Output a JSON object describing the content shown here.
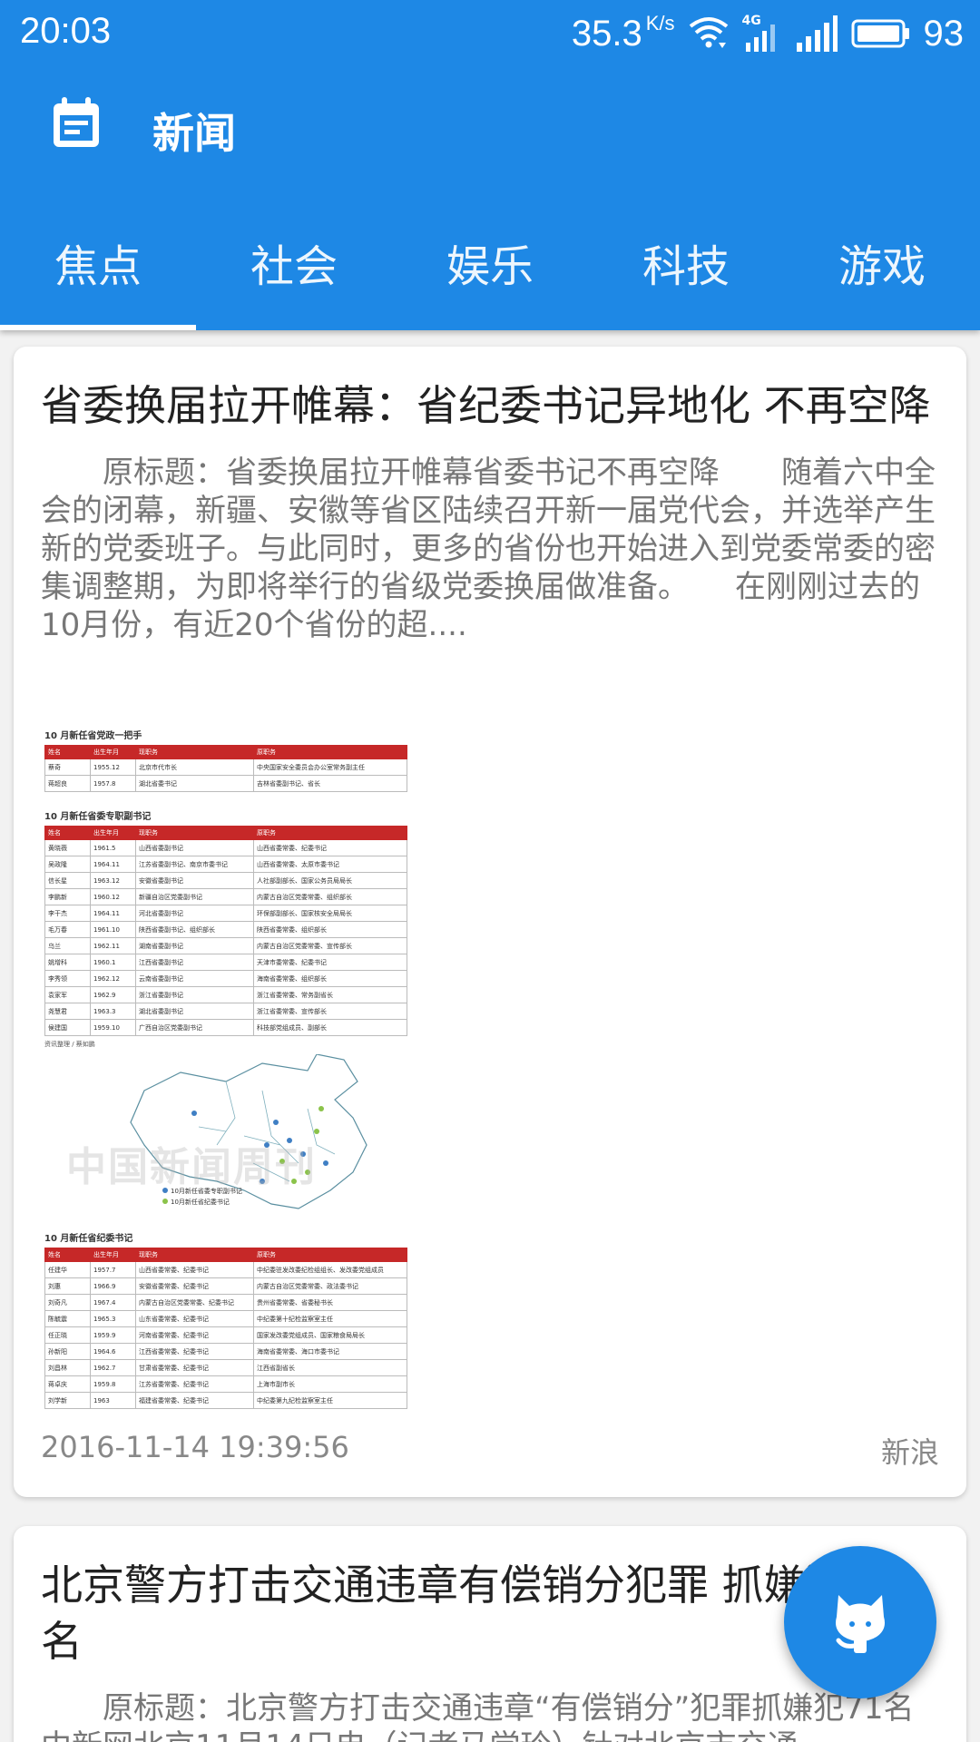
{
  "status_bar": {
    "time": "20:03",
    "net_speed": "35.3",
    "net_speed_unit": "K/s",
    "network_type": "4G",
    "battery": "93",
    "icons": [
      "wifi-icon",
      "signal-4g-icon",
      "signal-icon",
      "battery-icon"
    ]
  },
  "toolbar": {
    "title": "新闻",
    "icon": "calendar-icon"
  },
  "tabs": [
    {
      "label": "焦点",
      "active": true
    },
    {
      "label": "社会",
      "active": false
    },
    {
      "label": "娱乐",
      "active": false
    },
    {
      "label": "科技",
      "active": false
    },
    {
      "label": "游戏",
      "active": false
    }
  ],
  "articles": [
    {
      "title": "省委换届拉开帷幕：省纪委书记异地化 不再空降",
      "summary": "　　原标题：省委换届拉开帷幕省委书记不再空降　　随着六中全会的闭幕，新疆、安徽等省区陆续召开新一届党代会，并选举产生新的党委班子。与此同时，更多的省份也开始进入到党委常委的密集调整期，为即将举行的省级党委换届做准备。　　在刚刚过去的10月份，有近20个省份的超....",
      "time": "2016-11-14 19:39:56",
      "source": "新浪",
      "figure": {
        "table1": {
          "caption": "10 月新任省党政一把手",
          "headers": [
            "姓名",
            "出生年月",
            "现职务",
            "原职务"
          ],
          "rows": [
            [
              "蔡奇",
              "1955.12",
              "北京市代市长",
              "中央国家安全委员会办公室常务副主任"
            ],
            [
              "蒋超良",
              "1957.8",
              "湖北省委书记",
              "吉林省委副书记、省长"
            ]
          ]
        },
        "table2": {
          "caption": "10 月新任省委专职副书记",
          "headers": [
            "姓名",
            "出生年月",
            "现职务",
            "原职务"
          ],
          "rows": [
            [
              "黄晓薇",
              "1961.5",
              "山西省委副书记",
              "山西省委常委、纪委书记"
            ],
            [
              "吴政隆",
              "1964.11",
              "江苏省委副书记、南京市委书记",
              "山西省委常委、太原市委书记"
            ],
            [
              "信长星",
              "1963.12",
              "安徽省委副书记",
              "人社部副部长、国家公务员局局长"
            ],
            [
              "李鹏新",
              "1960.12",
              "新疆自治区党委副书记",
              "内蒙古自治区党委常委、组织部长"
            ],
            [
              "李干杰",
              "1964.11",
              "河北省委副书记",
              "环保部副部长、国家核安全局局长"
            ],
            [
              "毛万春",
              "1961.10",
              "陕西省委副书记、组织部长",
              "陕西省委常委、组织部长"
            ],
            [
              "乌兰",
              "1962.11",
              "湖南省委副书记",
              "内蒙古自治区党委常委、宣传部长"
            ],
            [
              "姚增科",
              "1960.1",
              "江西省委副书记",
              "天津市委常委、纪委书记"
            ],
            [
              "李秀领",
              "1962.12",
              "云南省委副书记",
              "海南省委常委、组织部长"
            ],
            [
              "袁家军",
              "1962.9",
              "浙江省委副书记",
              "浙江省委常委、常务副省长"
            ],
            [
              "尧慧君",
              "1963.3",
              "湖北省委副书记",
              "浙江省委常委、宣传部长"
            ],
            [
              "侯建国",
              "1959.10",
              "广西自治区党委副书记",
              "科技部党组成员、副部长"
            ]
          ],
          "source_note": "资讯整理 / 蔡如鹏"
        },
        "map": {
          "watermark": "中国新闻周刊",
          "legend": [
            "10月新任省委专职副书记",
            "10月新任省纪委书记"
          ],
          "colors": {
            "deputy": "#3f7fc4",
            "discipline": "#8bc34a"
          }
        },
        "table3": {
          "caption": "10 月新任省纪委书记",
          "headers": [
            "姓名",
            "出生年月",
            "现职务",
            "原职务"
          ],
          "rows": [
            [
              "任建华",
              "1957.7",
              "山西省委常委、纪委书记",
              "中纪委驻发改委纪检组组长、发改委党组成员"
            ],
            [
              "刘惠",
              "1966.9",
              "安徽省委常委、纪委书记",
              "内蒙古自治区党委常委、政法委书记"
            ],
            [
              "刘奇凡",
              "1967.4",
              "内蒙古自治区党委常委、纪委书记",
              "贵州省委常委、省委秘书长"
            ],
            [
              "陈毓震",
              "1965.3",
              "山东省委常委、纪委书记",
              "中纪委第十纪检监察室主任"
            ],
            [
              "任正晓",
              "1959.9",
              "河南省委常委、纪委书记",
              "国家发改委党组成员、国家粮食局局长"
            ],
            [
              "孙新阳",
              "1964.6",
              "江西省委常委、纪委书记",
              "海南省委常委、海口市委书记"
            ],
            [
              "刘昌林",
              "1962.7",
              "甘肃省委常委、纪委书记",
              "江西省副省长"
            ],
            [
              "蒋卓庆",
              "1959.8",
              "江苏省委常委、纪委书记",
              "上海市副市长"
            ],
            [
              "刘学新",
              "1963",
              "福建省委常委、纪委书记",
              "中纪委第九纪检监察室主任"
            ]
          ]
        }
      }
    },
    {
      "title": "北京警方打击交通违章有偿销分犯罪 抓嫌犯71名",
      "summary": "　　原标题：北京警方打击交通违章“有偿销分”犯罪抓嫌犯71名　　中新网北京11月14日电（记者马学玲）针对北京市交通"
    }
  ],
  "fab": {
    "icon": "github-octocat-icon"
  },
  "colors": {
    "primary": "#1e88e5",
    "card": "#ffffff",
    "background": "#f2f2f2",
    "table_header": "#c62828"
  }
}
